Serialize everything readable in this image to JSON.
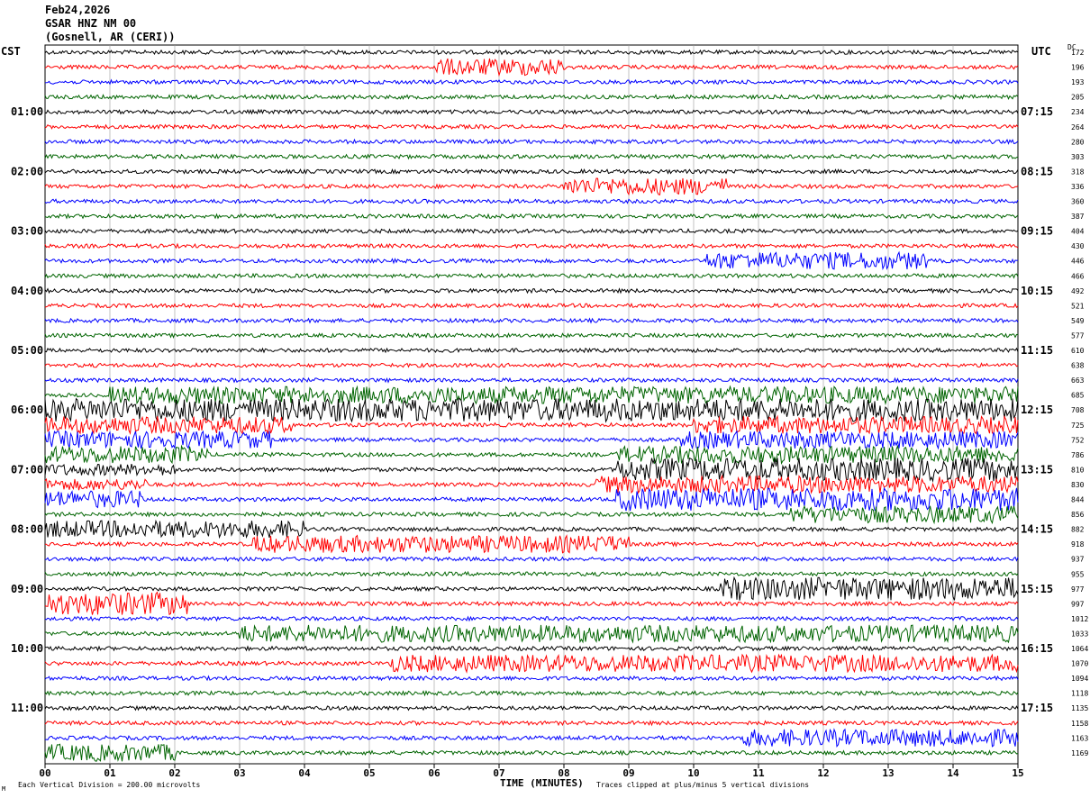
{
  "header": {
    "date": "Feb24,2026",
    "station": "GSAR HNZ NM 00",
    "location": "(Gosnell, AR (CERI))"
  },
  "labels": {
    "left_tz": "CST",
    "right_tz": "UTC",
    "dc": "DC",
    "scale_note": "Each Vertical Division =  200.00 microvolts",
    "clip_note": "Traces clipped at plus/minus 5 vertical divisions",
    "logo_text": "M"
  },
  "chart_data": {
    "type": "line",
    "title": "",
    "xlabel": "TIME (MINUTES)",
    "ylabel": "",
    "xlim": [
      0,
      15
    ],
    "x_ticks": [
      "00",
      "01",
      "02",
      "03",
      "04",
      "05",
      "06",
      "07",
      "08",
      "09",
      "10",
      "11",
      "12",
      "13",
      "14",
      "15"
    ],
    "grid": "vertical lines at each minute",
    "trace_colors": [
      "#000000",
      "#ff0000",
      "#0000ff",
      "#006400"
    ],
    "left_time_labels": [
      "01:00",
      "02:00",
      "03:00",
      "04:00",
      "05:00",
      "06:00",
      "07:00",
      "08:00",
      "09:00",
      "10:00",
      "11:00"
    ],
    "right_time_labels": [
      "07:15",
      "08:15",
      "09:15",
      "10:15",
      "11:15",
      "12:15",
      "13:15",
      "14:15",
      "15:15",
      "16:15",
      "17:15"
    ],
    "dc_offsets": [
      172,
      196,
      193,
      205,
      234,
      264,
      280,
      303,
      318,
      336,
      360,
      387,
      404,
      430,
      446,
      466,
      492,
      521,
      549,
      577,
      610,
      638,
      663,
      685,
      708,
      725,
      752,
      786,
      810,
      830,
      844,
      856,
      882,
      918,
      937,
      955,
      977,
      997,
      1012,
      1033,
      1064,
      1070,
      1094,
      1118,
      1135,
      1158,
      1163,
      1169
    ],
    "trace_count": 48,
    "noise_bursts": [
      {
        "trace": 1,
        "start": 6.0,
        "end": 8.0,
        "level": 3
      },
      {
        "trace": 9,
        "start": 8.0,
        "end": 10.5,
        "level": 3
      },
      {
        "trace": 14,
        "start": 10.2,
        "end": 13.6,
        "level": 3
      },
      {
        "trace": 23,
        "start": 1.0,
        "end": 15.0,
        "level": 3
      },
      {
        "trace": 24,
        "start": 0.0,
        "end": 15.0,
        "level": 4
      },
      {
        "trace": 25,
        "start": 0.0,
        "end": 3.8,
        "level": 3
      },
      {
        "trace": 25,
        "start": 10.0,
        "end": 15.0,
        "level": 3
      },
      {
        "trace": 26,
        "start": 0.0,
        "end": 3.5,
        "level": 3
      },
      {
        "trace": 26,
        "start": 9.8,
        "end": 15.0,
        "level": 3
      },
      {
        "trace": 27,
        "start": 0.0,
        "end": 2.5,
        "level": 3
      },
      {
        "trace": 27,
        "start": 8.8,
        "end": 15.0,
        "level": 3
      },
      {
        "trace": 28,
        "start": 0.0,
        "end": 2.0,
        "level": 2
      },
      {
        "trace": 28,
        "start": 8.8,
        "end": 15.0,
        "level": 4
      },
      {
        "trace": 29,
        "start": 0.0,
        "end": 1.6,
        "level": 2
      },
      {
        "trace": 29,
        "start": 8.5,
        "end": 15.0,
        "level": 3
      },
      {
        "trace": 30,
        "start": 0.0,
        "end": 1.5,
        "level": 3
      },
      {
        "trace": 30,
        "start": 8.8,
        "end": 15.0,
        "level": 4
      },
      {
        "trace": 31,
        "start": 11.5,
        "end": 15.0,
        "level": 3
      },
      {
        "trace": 32,
        "start": 0.0,
        "end": 4.0,
        "level": 3
      },
      {
        "trace": 33,
        "start": 3.2,
        "end": 9.0,
        "level": 3
      },
      {
        "trace": 36,
        "start": 10.4,
        "end": 15.0,
        "level": 4
      },
      {
        "trace": 37,
        "start": 0.0,
        "end": 2.2,
        "level": 4
      },
      {
        "trace": 39,
        "start": 3.0,
        "end": 15.0,
        "level": 3
      },
      {
        "trace": 41,
        "start": 5.3,
        "end": 15.0,
        "level": 3
      },
      {
        "trace": 46,
        "start": 10.7,
        "end": 15.0,
        "level": 3
      },
      {
        "trace": 47,
        "start": 0.0,
        "end": 2.0,
        "level": 3
      }
    ]
  }
}
